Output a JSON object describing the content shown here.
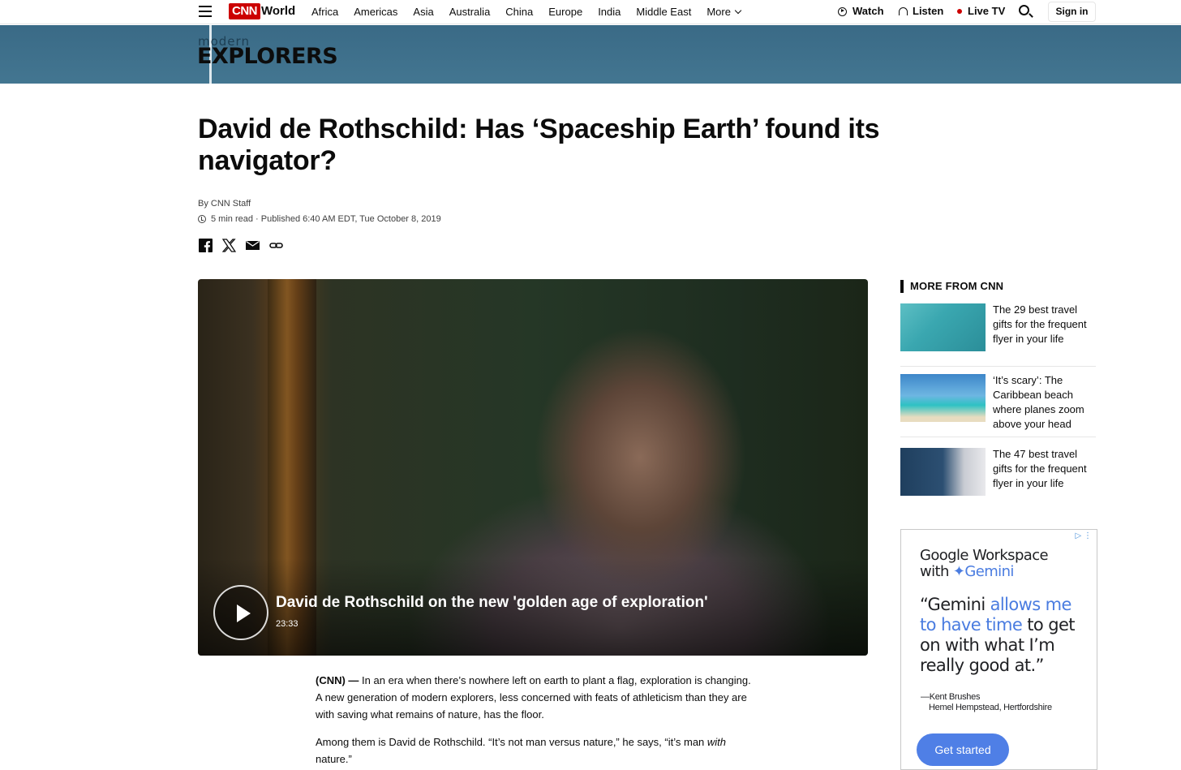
{
  "nav": {
    "logo": "CNN",
    "section": "World",
    "links": [
      "Africa",
      "Americas",
      "Asia",
      "Australia",
      "China",
      "Europe",
      "India",
      "Middle East",
      "More"
    ],
    "watch": "Watch",
    "listen": "Listen",
    "live_tv": "Live TV",
    "sign_in": "Sign in"
  },
  "banner": {
    "small": "modern",
    "big": "EXPLORERS"
  },
  "article": {
    "headline": "David de Rothschild: Has ‘Spaceship Earth’ found its navigator?",
    "byline": "By CNN Staff",
    "read_time": "5 min read",
    "published": "· Published 6:40 AM EDT, Tue October 8, 2019",
    "video": {
      "title": "David de Rothschild on the new 'golden age of exploration'",
      "duration": "23:33"
    },
    "p1_tag": "(CNN) —",
    "p1": " In an era when there’s nowhere left on earth to plant a flag, exploration is changing. A new generation of modern explorers, less concerned with feats of athleticism than they are with saving what remains of nature, has the floor.",
    "p2_a": "Among them is David de Rothschild. “It’s not man versus nature,” he says, “it’s man ",
    "p2_em": "with",
    "p2_b": " nature.”"
  },
  "sidebar": {
    "heading": "MORE FROM CNN",
    "cards": [
      {
        "title": "The 29 best travel gifts for the frequent flyer in your life"
      },
      {
        "title": "‘It’s scary’: The Caribbean beach where planes zoom above your head"
      },
      {
        "title": "The 47 best travel gifts for the frequent flyer in your life"
      }
    ]
  },
  "ad": {
    "brand_line1": "Google Workspace",
    "brand_with": "with ",
    "brand_gemini": "Gemini",
    "quote_a": "“Gemini ",
    "quote_hl": "allows me to have time",
    "quote_b": " to get on with what I’m really good at.”",
    "author_name": "—Kent Brushes",
    "author_place": "Hemel Hempstead, Hertfordshire",
    "cta": "Get started",
    "icons": "▷ ⋮"
  }
}
